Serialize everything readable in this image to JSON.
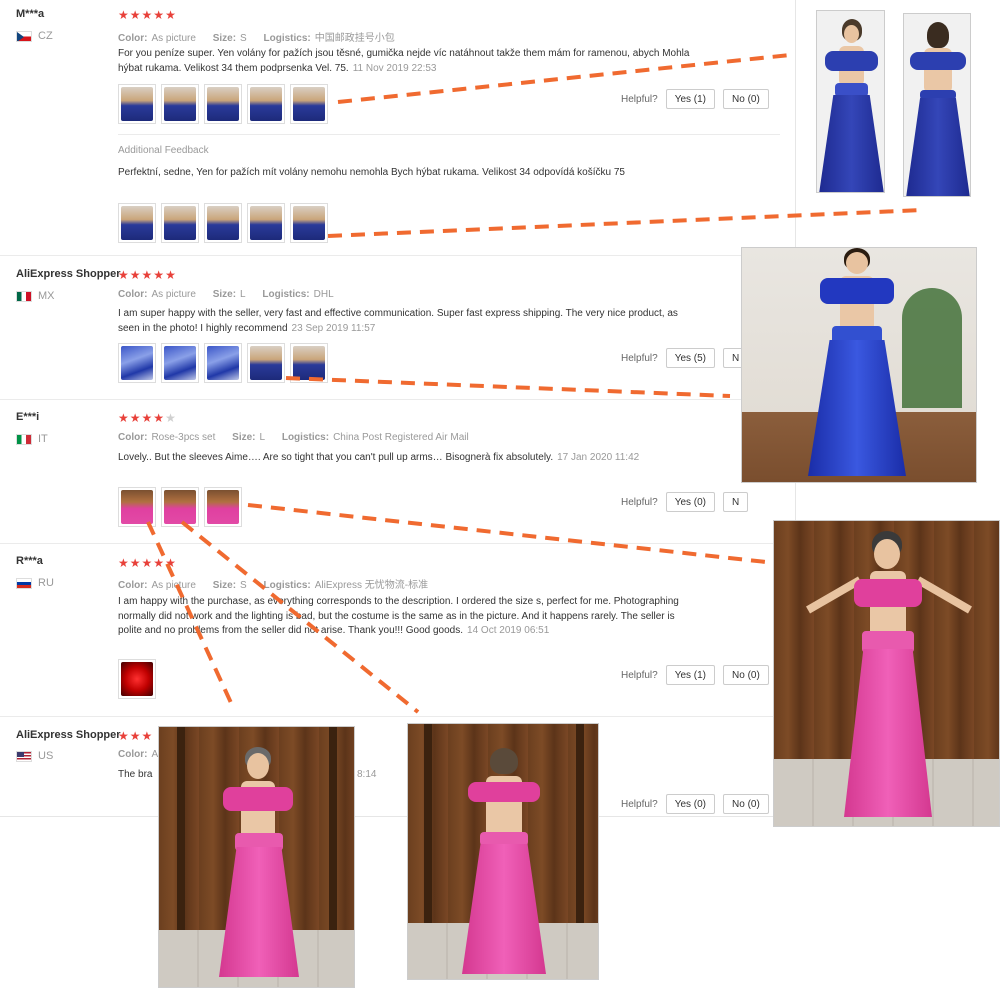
{
  "helpful_label": "Helpful?",
  "reviews": [
    {
      "user": "M***a",
      "country": "CZ",
      "rating": 5,
      "color_label": "Color:",
      "color": "As picture",
      "size_label": "Size:",
      "size": "S",
      "logistics_label": "Logistics:",
      "logistics": "中国邮政挂号小包",
      "text": "For you peníze super. Yen volány for pažích jsou těsné, gumička nejde víc natáhnout takže them mám for ramenou, abych Mohla hýbat rukama. Velikost 34 them podprsenka Vel. 75.",
      "date": "11 Nov 2019 22:53",
      "yes": "Yes (1)",
      "no": "No (0)",
      "additional_label": "Additional Feedback",
      "additional_text": "Perfektní, sedne, Yen for pažích mít volány nemohu nemohla Bych hýbat rukama. Velikost 34 odpovídá košíčku 75"
    },
    {
      "user": "AliExpress Shopper",
      "country": "MX",
      "rating": 5,
      "color_label": "Color:",
      "color": "As picture",
      "size_label": "Size:",
      "size": "L",
      "logistics_label": "Logistics:",
      "logistics": "DHL",
      "text": "I am super happy with the seller, very fast and effective communication. Super fast express shipping. The very nice product, as seen in the photo! I highly recommend",
      "date": "23 Sep 2019 11:57",
      "yes": "Yes (5)",
      "no": "N"
    },
    {
      "user": "E***i",
      "country": "IT",
      "rating": 4,
      "color_label": "Color:",
      "color": "Rose-3pcs set",
      "size_label": "Size:",
      "size": "L",
      "logistics_label": "Logistics:",
      "logistics": "China Post Registered Air Mail",
      "text": "Lovely.. But the sleeves Aime…. Are so tight that you can't pull up arms… Bisognerà fix absolutely.",
      "date": "17 Jan 2020 11:42",
      "yes": "Yes (0)",
      "no": "N"
    },
    {
      "user": "R***a",
      "country": "RU",
      "rating": 5,
      "color_label": "Color:",
      "color": "As picture",
      "size_label": "Size:",
      "size": "S",
      "logistics_label": "Logistics:",
      "logistics": "AliExpress 无忧物流-标准",
      "text": "I am happy with the purchase, as everything corresponds to the description. I ordered the size s, perfect for me. Photographing normally did not work and the lighting is bad, but the costume is the same as in the picture. And it happens rarely. The seller is polite and no problems from the seller did not arise. Thank you!!! Good goods.",
      "date": "14 Oct 2019 06:51",
      "yes": "Yes (1)",
      "no": "No (0)"
    },
    {
      "user": "AliExpress Shopper",
      "country": "US",
      "rating": 3,
      "color_label": "Color:",
      "color": "A",
      "text": "The bra",
      "date": "8:14",
      "yes": "Yes (0)",
      "no": "No (0)"
    }
  ]
}
